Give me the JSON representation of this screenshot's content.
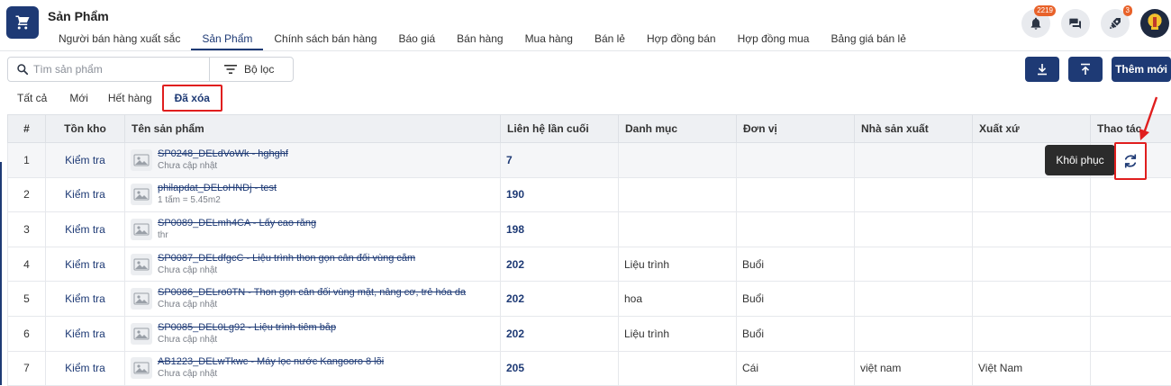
{
  "app": {
    "title": "Sản Phẩm",
    "icon": "cart-icon"
  },
  "top_nav": [
    {
      "label": "Người bán hàng xuất sắc"
    },
    {
      "label": "Sản Phẩm",
      "active": true
    },
    {
      "label": "Chính sách bán hàng"
    },
    {
      "label": "Báo giá"
    },
    {
      "label": "Bán hàng"
    },
    {
      "label": "Mua hàng"
    },
    {
      "label": "Bán lẻ"
    },
    {
      "label": "Hợp đồng bán"
    },
    {
      "label": "Hợp đồng mua"
    },
    {
      "label": "Bảng giá bán lẻ"
    }
  ],
  "header_icons": {
    "notifications_badge": "2219",
    "rocket_badge": "3"
  },
  "search": {
    "placeholder": "Tìm sản phẩm"
  },
  "filter": {
    "label": "Bộ lọc"
  },
  "actions": {
    "add_label": "Thêm mới"
  },
  "sub_tabs": [
    {
      "label": "Tất cả"
    },
    {
      "label": "Mới"
    },
    {
      "label": "Hết hàng"
    },
    {
      "label": "Đã xóa",
      "active": true
    }
  ],
  "table": {
    "headers": [
      "#",
      "Tồn kho",
      "Tên sản phẩm",
      "Liên hệ lần cuối",
      "Danh mục",
      "Đơn vị",
      "Nhà sản xuất",
      "Xuất xứ",
      "Thao tác"
    ],
    "rows": [
      {
        "idx": "1",
        "stock": "Kiểm tra",
        "name": "SP0248_DELdVoWk - hghghf",
        "sub": "Chưa cập nhật",
        "contact": "7",
        "category": "",
        "unit": "",
        "maker": "",
        "origin": ""
      },
      {
        "idx": "2",
        "stock": "Kiểm tra",
        "name": "philapdat_DELoHNDj - test",
        "sub": "1 tấm = 5.45m2",
        "contact": "190",
        "category": "",
        "unit": "",
        "maker": "",
        "origin": ""
      },
      {
        "idx": "3",
        "stock": "Kiểm tra",
        "name": "SP0089_DELmh4CA - Lấy cao răng",
        "sub": "thr",
        "contact": "198",
        "category": "",
        "unit": "",
        "maker": "",
        "origin": ""
      },
      {
        "idx": "4",
        "stock": "Kiểm tra",
        "name": "SP0087_DELdfgcC - Liệu trình thon gọn cân đối vùng cằm",
        "sub": "Chưa cập nhật",
        "contact": "202",
        "category": "Liệu trình",
        "unit": "Buổi",
        "maker": "",
        "origin": ""
      },
      {
        "idx": "5",
        "stock": "Kiểm tra",
        "name": "SP0086_DELro0TN - Thon gọn cân đối vùng mặt, nâng cơ, trẻ hóa da",
        "sub": "Chưa cập nhật",
        "contact": "202",
        "category": "hoa",
        "unit": "Buổi",
        "maker": "",
        "origin": ""
      },
      {
        "idx": "6",
        "stock": "Kiểm tra",
        "name": "SP0085_DEL0Lg92 - Liệu trình tiêm bắp",
        "sub": "Chưa cập nhật",
        "contact": "202",
        "category": "Liệu trình",
        "unit": "Buổi",
        "maker": "",
        "origin": ""
      },
      {
        "idx": "7",
        "stock": "Kiểm tra",
        "name": "AB1223_DELwTkwc - Máy lọc nước Kangooro 8 lõi",
        "sub": "Chưa cập nhật",
        "contact": "205",
        "category": "",
        "unit": "Cái",
        "maker": "việt nam",
        "origin": "Việt Nam"
      }
    ]
  },
  "tooltip": {
    "restore_label": "Khôi phục"
  },
  "colors": {
    "primary": "#1e3a75",
    "highlight": "#e01e1e",
    "badge": "#e8622a"
  }
}
